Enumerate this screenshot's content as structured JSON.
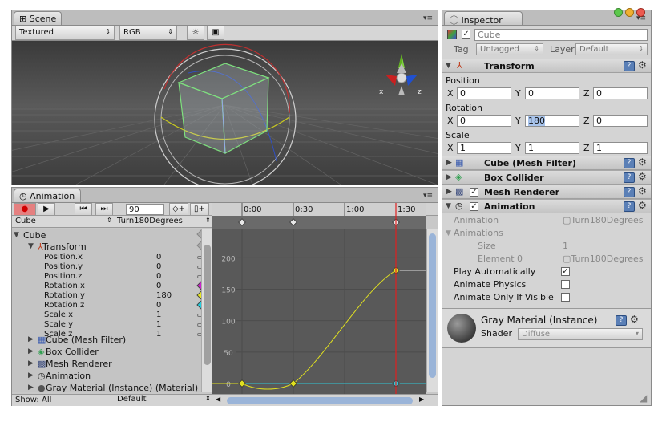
{
  "scene": {
    "tab": "Scene",
    "render_mode": "Textured",
    "color_mode": "RGB",
    "axis_x": "x",
    "axis_z": "z"
  },
  "animation": {
    "tab": "Animation",
    "frame": "90",
    "object_select": "Cube",
    "clip_select": "Turn180Degrees",
    "timeline": [
      "0:00",
      "0:30",
      "1:00",
      "1:30"
    ],
    "y_ticks": [
      "200",
      "150",
      "100",
      "50",
      "0"
    ],
    "show_label": "Show: All",
    "show_select": "Default",
    "tree": [
      {
        "label": "Cube",
        "value": ""
      },
      {
        "label": "Transform",
        "value": ""
      },
      {
        "label": "Position.x",
        "value": "0"
      },
      {
        "label": "Position.y",
        "value": "0"
      },
      {
        "label": "Position.z",
        "value": "0"
      },
      {
        "label": "Rotation.x",
        "value": "0"
      },
      {
        "label": "Rotation.y",
        "value": "180"
      },
      {
        "label": "Rotation.z",
        "value": "0"
      },
      {
        "label": "Scale.x",
        "value": "1"
      },
      {
        "label": "Scale.y",
        "value": "1"
      },
      {
        "label": "Scale.z",
        "value": "1"
      },
      {
        "label": "Cube (Mesh Filter)",
        "value": ""
      },
      {
        "label": "Box Collider",
        "value": ""
      },
      {
        "label": "Mesh Renderer",
        "value": ""
      },
      {
        "label": "Animation",
        "value": ""
      },
      {
        "label": "Gray Material (Instance) (Material)",
        "value": ""
      }
    ],
    "key_colors": {
      "rotation_x": "#d020d0",
      "rotation_y": "#e8e820",
      "rotation_z": "#20d0e0"
    },
    "curve": {
      "keys_time_s": [
        0,
        30,
        90
      ],
      "keys_value": [
        0,
        0,
        180
      ]
    }
  },
  "inspector": {
    "tab": "Inspector",
    "object_name": "Cube",
    "tag_label": "Tag",
    "tag_value": "Untagged",
    "layer_label": "Layer",
    "layer_value": "Default",
    "transform": {
      "title": "Transform",
      "position_label": "Position",
      "position": {
        "x": "0",
        "y": "0",
        "z": "0"
      },
      "rotation_label": "Rotation",
      "rotation": {
        "x": "0",
        "y": "180",
        "z": "0"
      },
      "scale_label": "Scale",
      "scale": {
        "x": "1",
        "y": "1",
        "z": "1"
      },
      "x_label": "X",
      "y_label": "Y",
      "z_label": "Z"
    },
    "components": [
      "Cube (Mesh Filter)",
      "Box Collider",
      "Mesh Renderer",
      "Animation"
    ],
    "anim": {
      "animation_label": "Animation",
      "animation_value": "Turn180Degrees",
      "animations_label": "Animations",
      "size_label": "Size",
      "size_value": "1",
      "element_label": "Element 0",
      "element_value": "Turn180Degrees",
      "play_label": "Play Automatically",
      "physics_label": "Animate Physics",
      "visible_label": "Animate Only If Visible"
    },
    "material": {
      "title": "Gray Material (Instance)",
      "shader_label": "Shader",
      "shader_value": "Diffuse"
    }
  }
}
